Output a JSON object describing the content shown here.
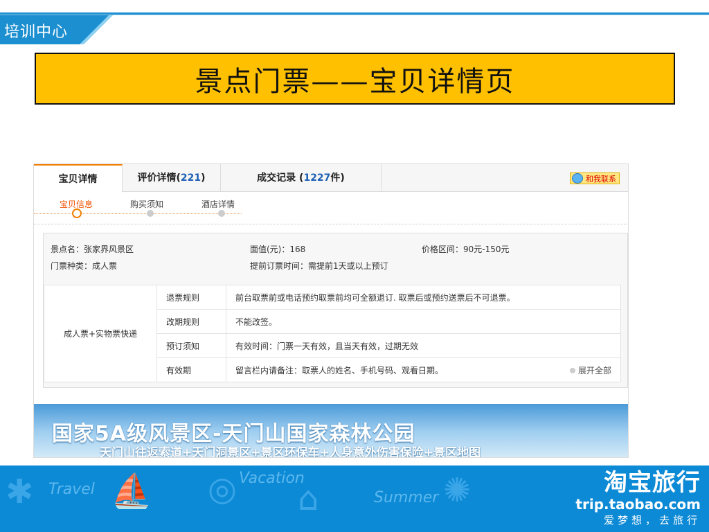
{
  "header": {
    "badge": "培训中心"
  },
  "title": "景点门票——宝贝详情页",
  "tabs": [
    {
      "label": "宝贝详情",
      "count": ""
    },
    {
      "label": "评价详情(",
      "count": "221",
      "suffix": ")"
    },
    {
      "label": "成交记录 (",
      "count": "1227",
      "suffix": "件)"
    }
  ],
  "contact_label": "和我联系",
  "subnav": [
    "宝贝信息",
    "购买须知",
    "酒店详情"
  ],
  "info": {
    "spot": "景点名：张家界风景区",
    "ticket_type": "门票种类：成人票",
    "face_value": "面值(元)：168",
    "advance": "提前订票时间：需提前1天或以上预订",
    "price_range": "价格区间：90元-150元"
  },
  "rules": {
    "group_label": "成人票+实物票快递",
    "rows": [
      {
        "label": "退票规则",
        "value": "前台取票前或电话预约取票前均可全额退订. 取票后或预约送票后不可退票。"
      },
      {
        "label": "改期规则",
        "value": "不能改签。"
      },
      {
        "label": "预订须知",
        "value": "有效时间：门票一天有效，且当天有效，过期无效"
      },
      {
        "label": "有效期",
        "value": "留言栏内请备注：取票人的姓名、手机号码、观看日期。"
      }
    ],
    "expand_label": "展开全部"
  },
  "banner": {
    "title": "国家5A级风景区-天门山国家森林公园",
    "subtitle": "天门山往返索道+天门洞景区+景区环保车+人身意外伤害保险+景区地图"
  },
  "footer": {
    "brand_cn": "淘宝旅行",
    "brand_en": "trip.taobao.com",
    "slogan": "爱梦想，去旅行",
    "decor_words": [
      "Travel",
      "Vacation",
      "Summer"
    ]
  }
}
